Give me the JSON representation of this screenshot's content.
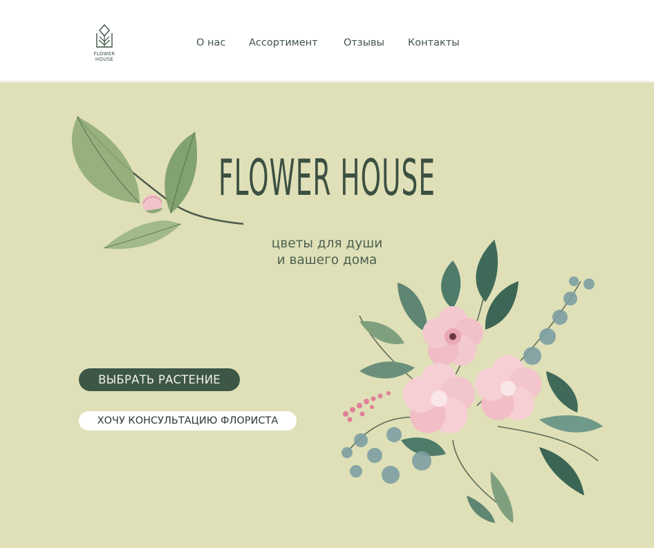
{
  "brand": {
    "logo_line1": "FLOWER",
    "logo_line2": "HOUSE"
  },
  "nav": {
    "items": [
      {
        "label": "О нас"
      },
      {
        "label": "Ассортимент"
      },
      {
        "label": "Отзывы"
      },
      {
        "label": "Контакты"
      }
    ]
  },
  "hero": {
    "title": "FLOWER HOUSE",
    "subtitle_line1": "цветы для души",
    "subtitle_line2": "и вашего дома",
    "primary_button": "ВЫБРАТЬ РАСТЕНИЕ",
    "secondary_button": "ХОЧУ КОНСУЛЬТАЦИЮ ФЛОРИСТА"
  },
  "colors": {
    "hero_background": "#dfe0b7",
    "header_background": "#ffffff",
    "accent_dark_green": "#3d5645",
    "text_green": "#3f5547",
    "flower_pink": "#f2c3c9"
  },
  "illustrations": {
    "branch": "leaf-branch-with-pink-bud-icon",
    "bouquet": "pink-flowers-bouquet-icon",
    "logo": "flower-house-logo-icon"
  }
}
